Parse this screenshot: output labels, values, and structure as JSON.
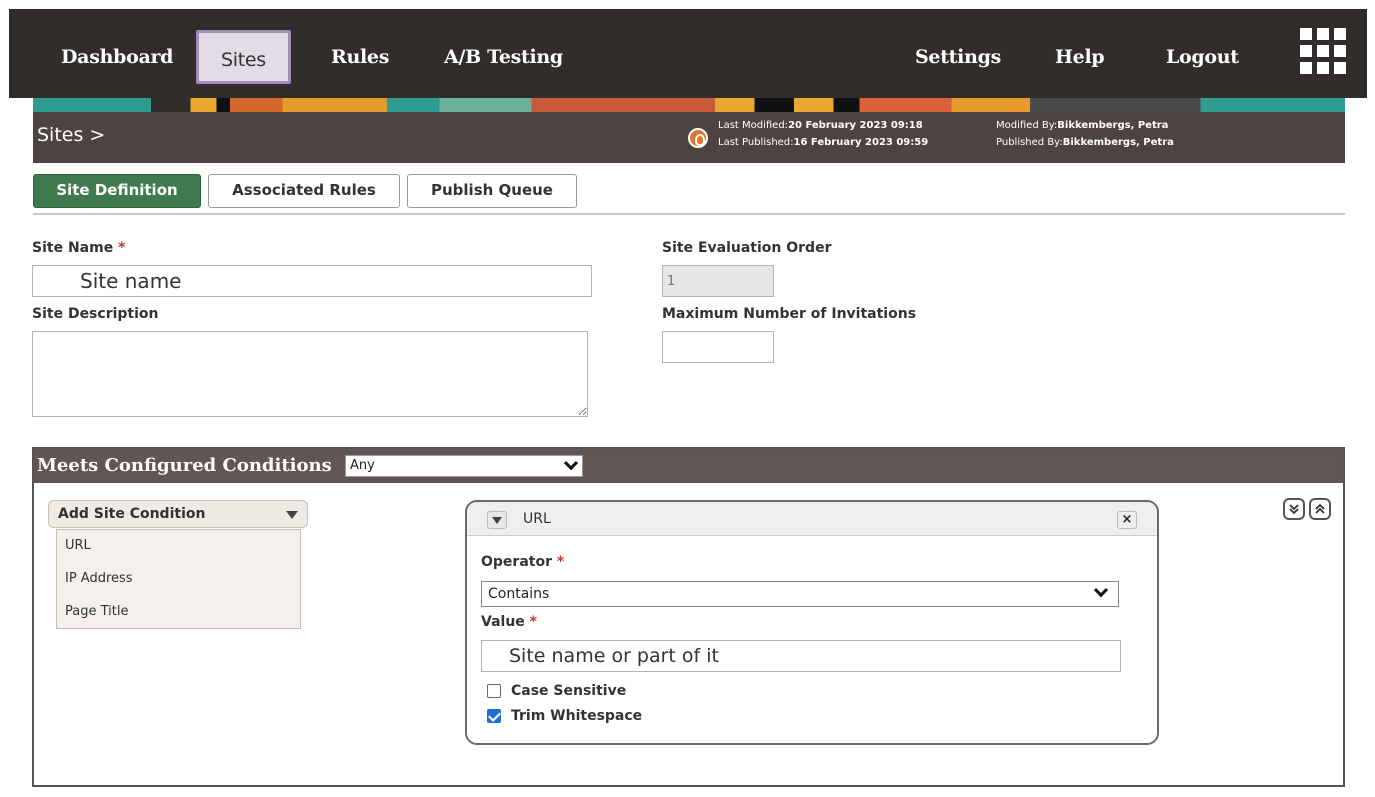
{
  "nav": {
    "dashboard": "Dashboard",
    "sites": "Sites",
    "rules": "Rules",
    "ab_testing": "A/B Testing",
    "settings": "Settings",
    "help": "Help",
    "logout": "Logout",
    "apps_icon": "grid-icon"
  },
  "header": {
    "breadcrumb": "Sites >",
    "last_modified_label": "Last Modified:",
    "last_modified_value": "20 February 2023 09:18",
    "last_published_label": "Last Published:",
    "last_published_value": "16 February 2023 09:59",
    "modified_by_label": "Modified By:",
    "modified_by_value": "Bikkembergs, Petra",
    "published_by_label": "Published By:",
    "published_by_value": "Bikkembergs, Petra"
  },
  "tabs": {
    "site_definition": "Site Definition",
    "associated_rules": "Associated Rules",
    "publish_queue": "Publish Queue"
  },
  "form": {
    "site_name_label": "Site Name",
    "site_name_value": "Site name",
    "site_description_label": "Site Description",
    "site_description_value": "",
    "evaluation_order_label": "Site Evaluation Order",
    "evaluation_order_value": "1",
    "max_invitations_label": "Maximum Number of Invitations",
    "max_invitations_value": "",
    "required_marker": "*"
  },
  "conditions": {
    "title": "Meets Configured Conditions",
    "match_value": "Any",
    "add_button": "Add Site Condition",
    "menu_items": [
      "URL",
      "IP Address",
      "Page Title"
    ],
    "card": {
      "title": "URL",
      "close": "×",
      "operator_label": "Operator",
      "operator_value": "Contains",
      "value_label": "Value",
      "value_value": "Site name or part of it",
      "case_sensitive_label": "Case Sensitive",
      "case_sensitive_checked": false,
      "trim_whitespace_label": "Trim Whitespace",
      "trim_whitespace_checked": true
    }
  },
  "colors": {
    "nav_bg": "#312d2a",
    "active_tab": "#3e7a4d",
    "header_bg": "#4d4441",
    "accent_orange": "#e2772e"
  }
}
